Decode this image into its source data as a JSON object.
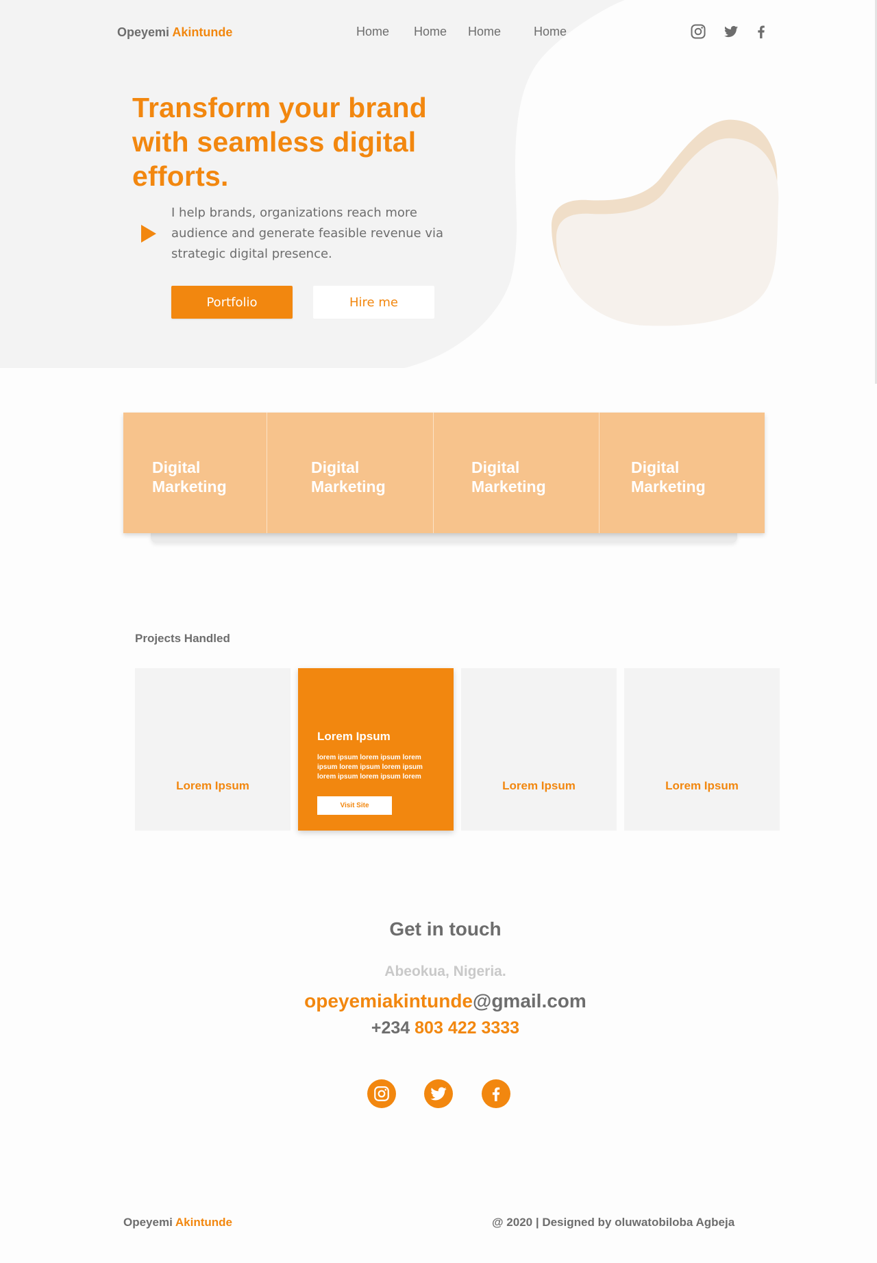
{
  "colors": {
    "accent": "#f2870f",
    "text": "#6d6d6d",
    "hero_bg": "#f3f3f3",
    "services_bg": "#f7c38c",
    "muted": "#c9c9c9"
  },
  "header": {
    "brand": {
      "first": "Opeyemi",
      "last": "Akintunde"
    },
    "nav": [
      "Home",
      "Home",
      "Home",
      "Home"
    ],
    "social_icons": [
      "instagram-icon",
      "twitter-icon",
      "facebook-icon"
    ]
  },
  "hero": {
    "headline": "Transform your brand with seamless digital efforts.",
    "description": "I help brands, organizations reach more audience and generate feasible revenue via strategic digital presence.",
    "primary_button": "Portfolio",
    "secondary_button": "Hire me"
  },
  "services": [
    "Digital\nMarketing",
    "Digital\nMarketing",
    "Digital\nMarketing",
    "Digital\nMarketing"
  ],
  "projects": {
    "title": "Projects Handled",
    "items": [
      "Lorem Ipsum",
      "Lorem Ipsum",
      "Lorem Ipsum",
      "Lorem Ipsum"
    ],
    "active": {
      "title": "Lorem Ipsum",
      "description": "lorem ipsum lorem ipsum lorem ipsum lorem ipsum lorem ipsum lorem ipsum lorem ipsum lorem",
      "button": "Visit Site"
    }
  },
  "contact": {
    "title": "Get in touch",
    "location": "Abeokua, Nigeria.",
    "email_user": "opeyemiakintunde",
    "email_domain": "@gmail.com",
    "phone_code": "+234",
    "phone_number": "803 422 3333",
    "social_icons": [
      "instagram-icon",
      "twitter-icon",
      "facebook-icon"
    ]
  },
  "footer": {
    "brand": {
      "first": "Opeyemi",
      "last": "Akintunde"
    },
    "credit": "@ 2020 | Designed by oluwatobiloba Agbeja"
  }
}
